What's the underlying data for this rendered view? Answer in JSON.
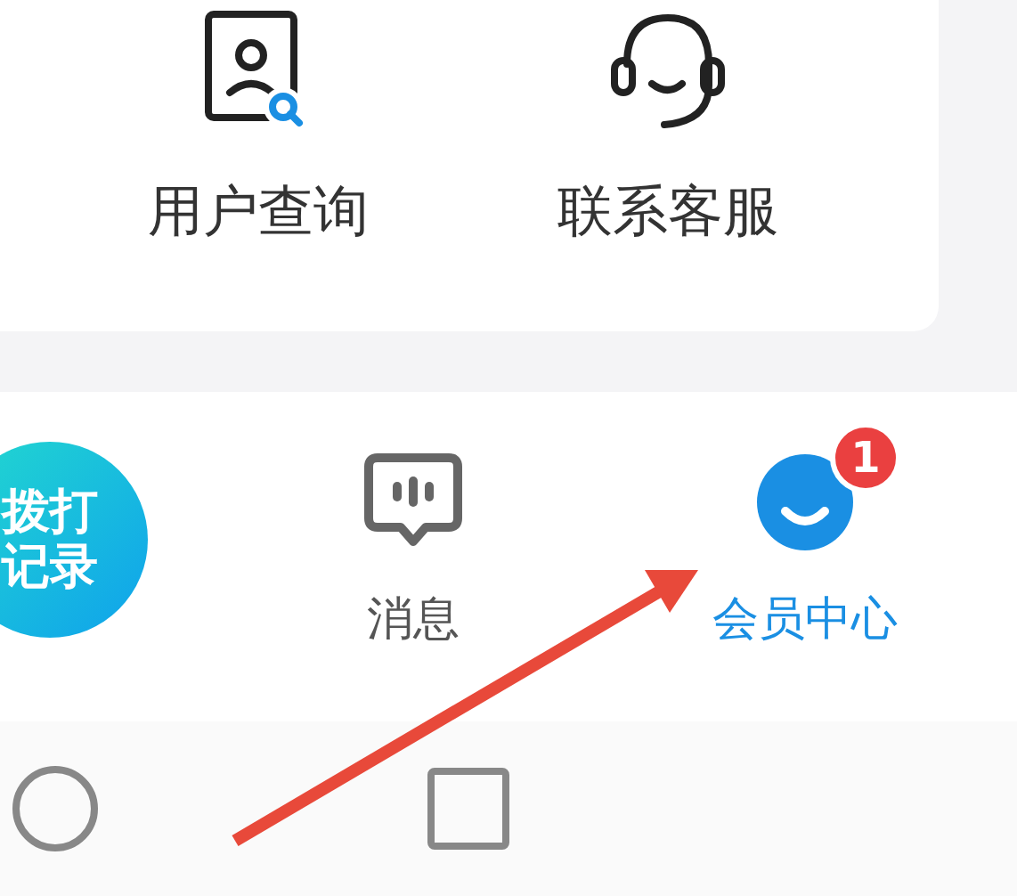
{
  "shortcuts": [
    {
      "label": "用户查询",
      "kind": "user-search"
    },
    {
      "label": "联系客服",
      "kind": "headset"
    }
  ],
  "tab_bar": [
    {
      "kind": "call-button",
      "lines": [
        "拨打",
        "记录"
      ],
      "selected": false
    },
    {
      "kind": "message",
      "label": "消息",
      "selected": false
    },
    {
      "kind": "member",
      "label": "会员中心",
      "selected": true,
      "badge": "1"
    }
  ],
  "annotation": {
    "kind": "arrow"
  }
}
